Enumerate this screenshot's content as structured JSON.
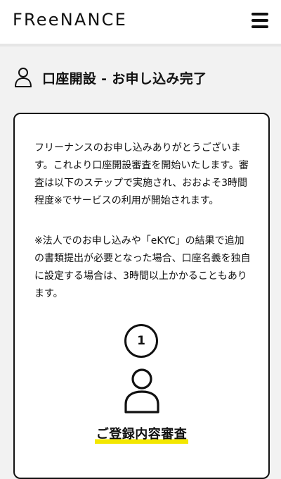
{
  "header": {
    "logo_text": "FReeNANCE",
    "menu_icon": "hamburger-menu-icon"
  },
  "page": {
    "title": "口座開設 - お申し込み完了",
    "title_icon": "person-icon"
  },
  "card": {
    "intro_text": "フリーナンスのお申し込みありがとうございます。これより口座開設審査を開始いたします。審査は以下のステップで実施され、おおよそ3時間程度※でサービスの利用が開始されます。",
    "note_text": "※法人でのお申し込みや「eKYC」の結果で追加の書類提出が必要となった場合、口座名義を独自に設定する場合は、3時間以上かかることもあります。",
    "steps": [
      {
        "number": "1",
        "icon": "person-icon",
        "label": "ご登録内容審査"
      }
    ]
  },
  "colors": {
    "highlight": "#f3e700",
    "text": "#111111",
    "background": "#f2f2f2",
    "card_border": "#111111"
  }
}
